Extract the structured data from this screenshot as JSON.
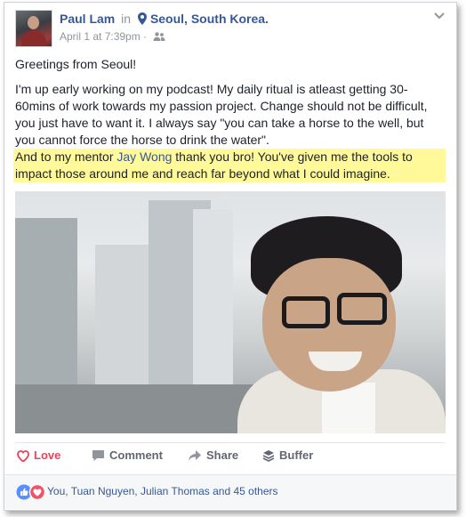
{
  "post": {
    "author": "Paul Lam",
    "in_text": "in",
    "location": "Seoul, South Korea.",
    "timestamp": "April 1 at 7:39pm",
    "sep": "·",
    "paragraphs": {
      "greeting": "Greetings from Seoul!",
      "body": "I'm up early working on my podcast! My daily ritual is atleast getting 30-60mins of work towards my passion project. Change should not be difficult, you just have to want it. I always say \"you can take a horse to the well, but you cannot force the horse to drink the water\".",
      "mention_pre": "And to my mentor ",
      "mention_name": "Jay Wong",
      "mention_post": " thank you bro! You've given me the tools to impact those around me and reach far beyond what I could imagine."
    },
    "highlight_color": "#fff99a",
    "link_color": "#365899"
  },
  "actions": {
    "love": "Love",
    "comment": "Comment",
    "share": "Share",
    "buffer": "Buffer"
  },
  "reactions": {
    "summary": "You, Tuan Nguyen, Julian Thomas and 45 others",
    "icons": [
      "like-icon",
      "love-icon"
    ]
  }
}
